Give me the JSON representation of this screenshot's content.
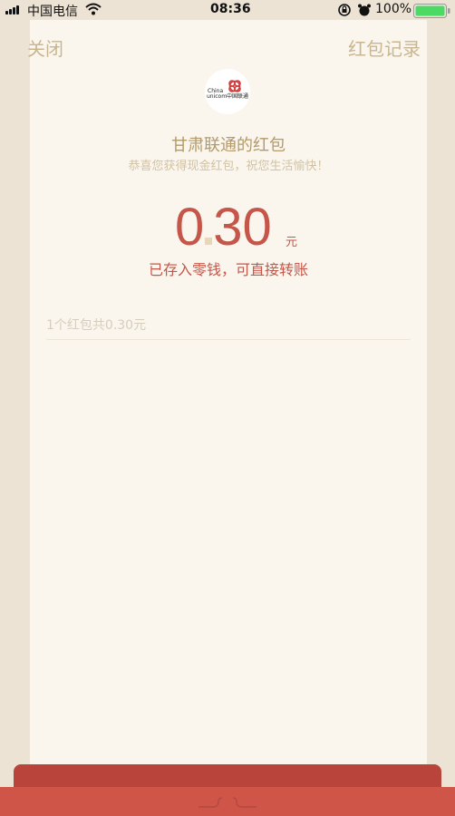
{
  "status_bar": {
    "carrier": "中国电信",
    "time": "08:36",
    "battery_percent": "100%",
    "icons": [
      "signal-icon",
      "wifi-icon",
      "rotation-lock-icon",
      "alarm-icon",
      "battery-icon"
    ]
  },
  "header": {
    "close_label": "关闭",
    "record_label": "红包记录"
  },
  "sender": {
    "logo_text_line1": "China",
    "logo_text_line2": "unicom中国联通",
    "name": "甘肃联通的红包",
    "greeting": "恭喜您获得现金红包，祝您生活愉快！"
  },
  "amount": {
    "integer": "0",
    "decimal": "30",
    "unit": "元",
    "deposit_text": "已存入零钱，可直接转账"
  },
  "summary": {
    "text": "1个红包共0.30元"
  },
  "colors": {
    "background": "#ece3d4",
    "card": "#faf6ed",
    "accent_gold": "#b49a6a",
    "amount_red": "#c5564a",
    "bottom_red": "#cf5548"
  }
}
